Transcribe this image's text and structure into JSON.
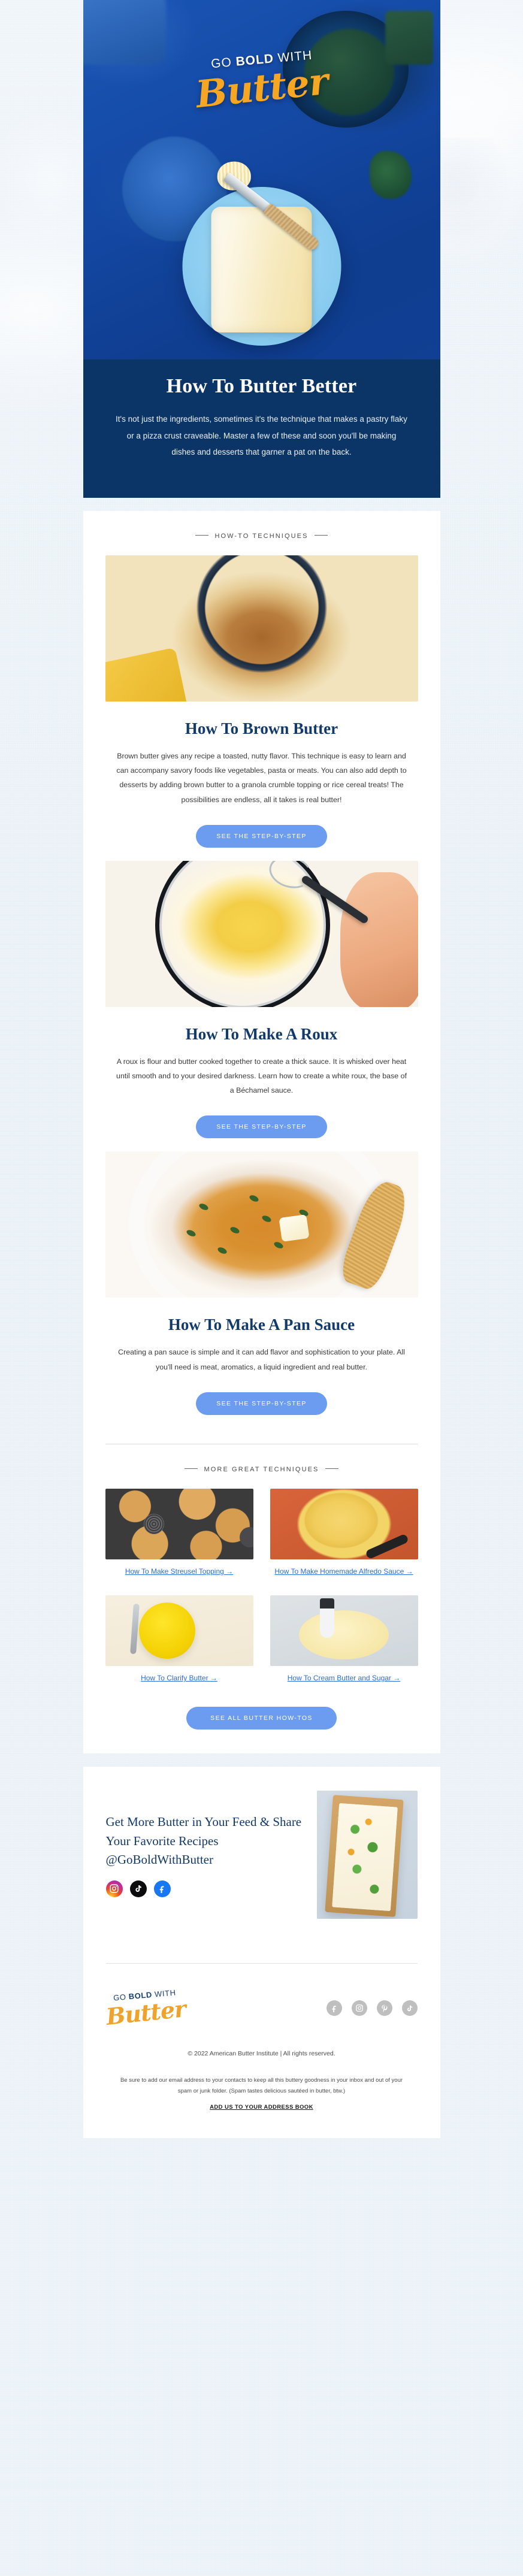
{
  "colors": {
    "page_bg": "#eaf1f7",
    "hero_navy": "#0b3566",
    "heading_navy": "#123a6b",
    "button_blue": "#6b9cef",
    "link_blue": "#2a6dd6",
    "logo_orange": "#f5a623"
  },
  "brand": {
    "logo_line1_pre": "GO ",
    "logo_line1_bold": "BOLD",
    "logo_line1_post": " WITH",
    "logo_line2": "Butter"
  },
  "hero": {
    "title": "How To Butter Better",
    "subtitle": "It's not just the ingredients, sometimes it's the technique that makes a pastry flaky or a pizza crust craveable. Master a few of these and soon you'll be making dishes and desserts that garner a pat on the back."
  },
  "section_labels": {
    "how_to_techniques": "HOW-TO TECHNIQUES",
    "more_great_techniques": "MORE GREAT TECHNIQUES"
  },
  "techniques": [
    {
      "title": "How To Brown Butter",
      "body": "Brown butter gives any recipe a toasted, nutty flavor. This technique is easy to learn and can accompany savory foods like vegetables, pasta or meats. You can also add depth to desserts by adding brown butter to a granola crumble topping or rice cereal treats! The possibilities are endless, all it takes is real butter!",
      "cta": "SEE THE STEP-BY-STEP",
      "image_alt": "brown-butter-in-yellow-pot"
    },
    {
      "title": "How To Make A Roux",
      "body": "A roux is flour and butter cooked together to create a thick sauce. It is whisked over heat until smooth and to your desired darkness. Learn how to create a white roux, the base of a Béchamel sauce.",
      "cta": "SEE THE STEP-BY-STEP",
      "image_alt": "whisking-roux-in-pan"
    },
    {
      "title": "How To Make A Pan Sauce",
      "body": "Creating a pan sauce is simple and it can add flavor and sophistication to your plate. All you'll need is meat, aromatics, a liquid ingredient and real butter.",
      "cta": "SEE THE STEP-BY-STEP",
      "image_alt": "pan-sauce-with-herbs-and-wooden-spoon"
    }
  ],
  "more_techniques": [
    {
      "label": "How To Make Streusel Topping →",
      "image_alt": "streusel-topping-in-muffin-tin"
    },
    {
      "label": "How To Make Homemade Alfredo Sauce →",
      "image_alt": "alfredo-pasta-in-orange-pan"
    },
    {
      "label": "How To Clarify Butter →",
      "image_alt": "clarified-butter-in-bowl-with-spoon"
    },
    {
      "label": "How To Cream Butter and Sugar →",
      "image_alt": "creamed-butter-and-sugar-in-mixer"
    }
  ],
  "see_all_button": "SEE ALL BUTTER HOW-TOS",
  "cta": {
    "title": "Get More Butter in Your Feed & Share Your Favorite Recipes @GoBoldWithButter",
    "image_alt": "puff-pastry-tart-with-herbs",
    "socials": [
      "instagram",
      "tiktok",
      "facebook"
    ]
  },
  "footer": {
    "socials": [
      "facebook",
      "instagram",
      "pinterest",
      "tiktok"
    ],
    "copyright": "© 2022 American Butter Institute | All rights reserved.",
    "legal": "Be sure to add our email address to your contacts to keep all this buttery goodness in your inbox and out of your spam or junk folder. (Spam tastes delicious sautéed in butter, btw.)",
    "address_book_link": "ADD US TO YOUR ADDRESS BOOK"
  }
}
